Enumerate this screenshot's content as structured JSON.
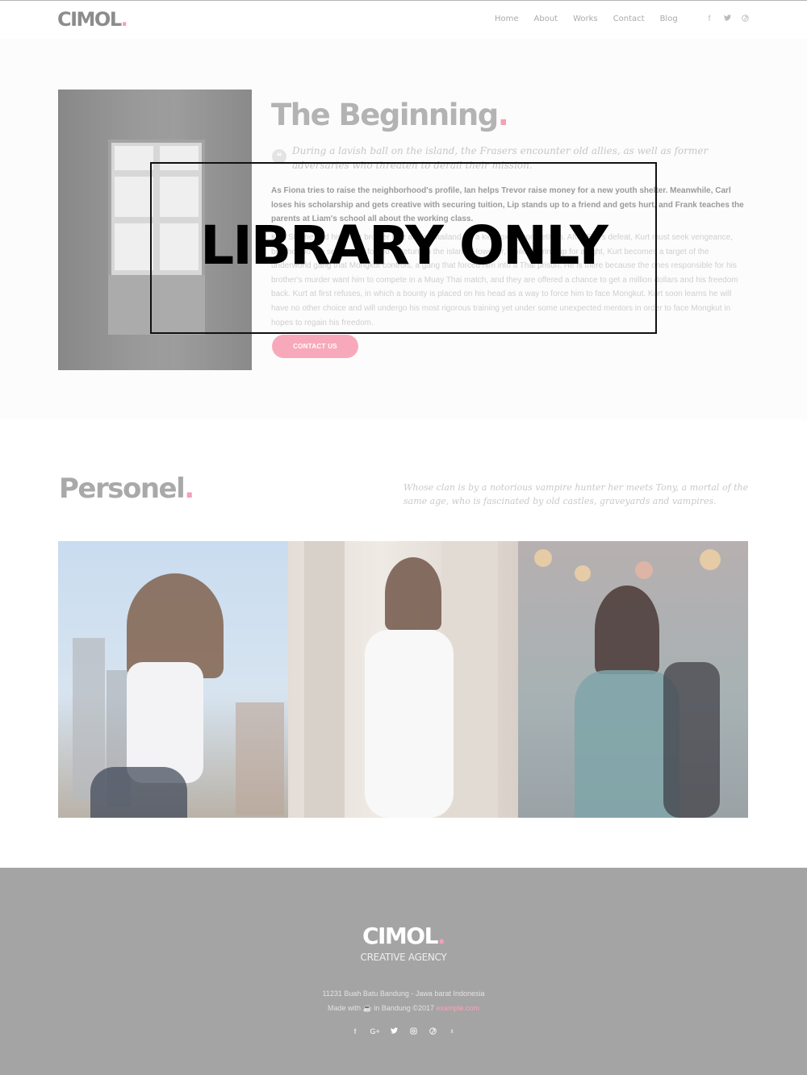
{
  "header": {
    "logo": "CIMOL",
    "logo_dot": ".",
    "nav": [
      "Home",
      "About",
      "Works",
      "Contact",
      "Blog"
    ],
    "social_icons": [
      "facebook-icon",
      "twitter-icon",
      "pinterest-icon"
    ],
    "social_glyphs": [
      "f",
      "🐦",
      "℗"
    ]
  },
  "beginning": {
    "title": "The Beginning",
    "title_dot": ".",
    "quote": "During a lavish ball on the island, the Frasers encounter old allies, as well as former adversaries who threaten to derail their mission.",
    "paragraph_bold": "As Fiona tries to raise the neighborhood's profile, Ian helps Trevor raise money for a new youth shelter. Meanwhile, Carl loses his scholarship and gets creative with securing tuition, Lip stands up to a friend and gets hurt, and Frank teaches the parents at Liam's school all about the working class.",
    "paragraph_light": "Kurt Sloane and his older brother Eric are in Thailand for a kickboxing competition. After Eric's defeat, Kurt must seek vengeance, but the two are separated, forced to return to the island. However, while gearing up for a fight, Kurt becomes a target of the underworld gang that Mongkut controls, a gang that forced him into a Thai prison. He is there because the ones responsible for his brother's murder want him to compete in a Muay Thai match, and they are offered a chance to get a million dollars and his freedom back. Kurt at first refuses, in which a bounty is placed on his head as a way to force him to face Mongkut. Kurt soon learns he will have no other choice and will undergo his most rigorous training yet under some unexpected mentors in order to face Mongkut in hopes to regain his freedom.",
    "button": "CONTACT US"
  },
  "watermark": "LIBRARY ONLY",
  "personel": {
    "title": "Personel",
    "title_dot": ".",
    "quote": "Whose clan is by a notorious vampire hunter her meets Tony, a mortal of the same age, who is fascinated by old castles, graveyards and vampires."
  },
  "footer": {
    "logo": "CIMOL",
    "logo_dot": ".",
    "tagline": "CREATIVE AGENCY",
    "address": "11231 Buah Batu Bandung - Jawa barat Indonesia",
    "made_prefix": "Made with",
    "made_icon": "coffee-icon",
    "made_middle": "in Bandung ©2017",
    "made_link": "example.com",
    "social_icons": [
      "facebook-icon",
      "google-plus-icon",
      "twitter-icon",
      "instagram-icon",
      "pinterest-icon",
      "xing-icon"
    ],
    "social_glyphs": [
      "f",
      "G+",
      "🐦",
      "◎",
      "℗",
      "ᵡ"
    ]
  },
  "colors": {
    "accent": "#f4a0b5",
    "footer_bg": "#a4a4a4"
  }
}
